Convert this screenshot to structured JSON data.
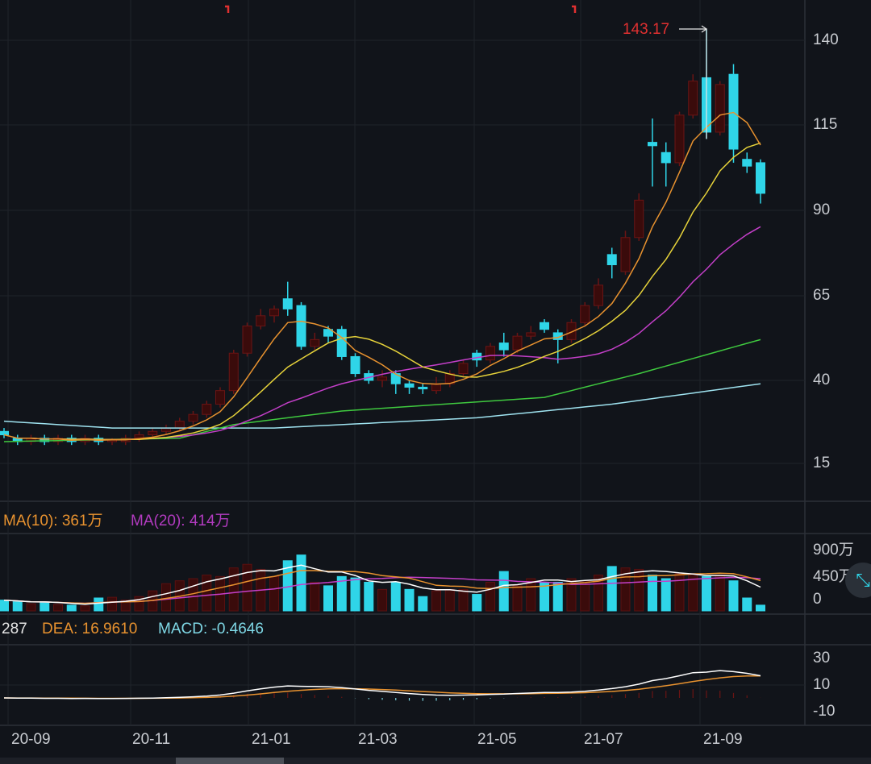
{
  "colors": {
    "up": "#8b1a1a",
    "down": "#2fd5e8",
    "ma5": "#e8922f",
    "ma10": "#e6d23a",
    "ma20": "#c43fc9",
    "ma60": "#3fc93f",
    "ma120": "#9fe3f0",
    "dif": "#ffffff",
    "dea": "#e8922f"
  },
  "volume_header": {
    "ma10": "MA(10): 361万",
    "ma20": "MA(20): 414万"
  },
  "macd_header": {
    "dif": "287",
    "dea": "DEA: 16.9610",
    "macd": "MACD: -0.4646"
  },
  "max_marker": "143.17",
  "price_axis": [
    "140",
    "115",
    "90",
    "65",
    "40",
    "15"
  ],
  "volume_axis": [
    "900万",
    "450万",
    "0"
  ],
  "macd_axis": [
    "30",
    "10",
    "-10"
  ],
  "date_axis": [
    "20-09",
    "20-11",
    "21-01",
    "21-03",
    "21-05",
    "21-07",
    "21-09"
  ],
  "chart_data": {
    "type": "candlestick",
    "price_ylim": [
      10,
      150
    ],
    "candles_ochl": [
      [
        25,
        24,
        26,
        23
      ],
      [
        23,
        22,
        24,
        21
      ],
      [
        22,
        23,
        24,
        21
      ],
      [
        23,
        22,
        24,
        21
      ],
      [
        22,
        23,
        24,
        21
      ],
      [
        23,
        22,
        24,
        21
      ],
      [
        22,
        23,
        24,
        21
      ],
      [
        23,
        22,
        24,
        21
      ],
      [
        22,
        22.5,
        23,
        21
      ],
      [
        22,
        23,
        24,
        21
      ],
      [
        23,
        24,
        25,
        22
      ],
      [
        24,
        25,
        26,
        23
      ],
      [
        25,
        26,
        27,
        24
      ],
      [
        26,
        28,
        29,
        25
      ],
      [
        28,
        30,
        31,
        27
      ],
      [
        30,
        33,
        34,
        29
      ],
      [
        33,
        37,
        38,
        32
      ],
      [
        37,
        48,
        49,
        36
      ],
      [
        48,
        56,
        57,
        47
      ],
      [
        56,
        59,
        61,
        55
      ],
      [
        59,
        61,
        62,
        57
      ],
      [
        64,
        61,
        69,
        59
      ],
      [
        62,
        50,
        63,
        49
      ],
      [
        50,
        52,
        54,
        49
      ],
      [
        55,
        53,
        56,
        51
      ],
      [
        55,
        47,
        56,
        46
      ],
      [
        47,
        42,
        48,
        41
      ],
      [
        42,
        40,
        43,
        39
      ],
      [
        40,
        41,
        43,
        38
      ],
      [
        42,
        39,
        43,
        36
      ],
      [
        39,
        38,
        40,
        36
      ],
      [
        38,
        37.5,
        39,
        36
      ],
      [
        37,
        39,
        41,
        36
      ],
      [
        39,
        42,
        43,
        38
      ],
      [
        42,
        45,
        46,
        41
      ],
      [
        48,
        46,
        49,
        44
      ],
      [
        46,
        50,
        51,
        45
      ],
      [
        51,
        49,
        54,
        47
      ],
      [
        49,
        53,
        54,
        48
      ],
      [
        53,
        54,
        56,
        52
      ],
      [
        57,
        55,
        58,
        54
      ],
      [
        54,
        52,
        55,
        45
      ],
      [
        52,
        57,
        58,
        51
      ],
      [
        57,
        62,
        63,
        56
      ],
      [
        62,
        68,
        70,
        61
      ],
      [
        77,
        74,
        79,
        70
      ],
      [
        72,
        82,
        84,
        71
      ],
      [
        82,
        93,
        95,
        81
      ],
      [
        110,
        109,
        117,
        97
      ],
      [
        107,
        104,
        110,
        97
      ],
      [
        104,
        118,
        119,
        103
      ],
      [
        118,
        128,
        130,
        117
      ],
      [
        129,
        113,
        143.17,
        111
      ],
      [
        113,
        127,
        128,
        112
      ],
      [
        130,
        108,
        133,
        104
      ],
      [
        105,
        103,
        107,
        101
      ],
      [
        104,
        95,
        105,
        92
      ]
    ],
    "ma60_points": [
      [
        0,
        22
      ],
      [
        13,
        23
      ],
      [
        17,
        27
      ],
      [
        25,
        31
      ],
      [
        40,
        35
      ],
      [
        47,
        42
      ],
      [
        56,
        52
      ]
    ],
    "ma120_points": [
      [
        0,
        28
      ],
      [
        8,
        26
      ],
      [
        20,
        26
      ],
      [
        35,
        29
      ],
      [
        45,
        33
      ],
      [
        56,
        39
      ]
    ],
    "volume": [
      150,
      130,
      100,
      120,
      90,
      80,
      70,
      180,
      190,
      150,
      200,
      280,
      380,
      420,
      450,
      500,
      480,
      600,
      650,
      580,
      480,
      700,
      780,
      400,
      350,
      480,
      460,
      400,
      300,
      400,
      300,
      200,
      280,
      300,
      300,
      230,
      400,
      550,
      350,
      450,
      400,
      400,
      450,
      420,
      500,
      620,
      600,
      580,
      500,
      450,
      520,
      520,
      480,
      500,
      420,
      180,
      80
    ],
    "volume_ylim": [
      0,
      900
    ]
  }
}
